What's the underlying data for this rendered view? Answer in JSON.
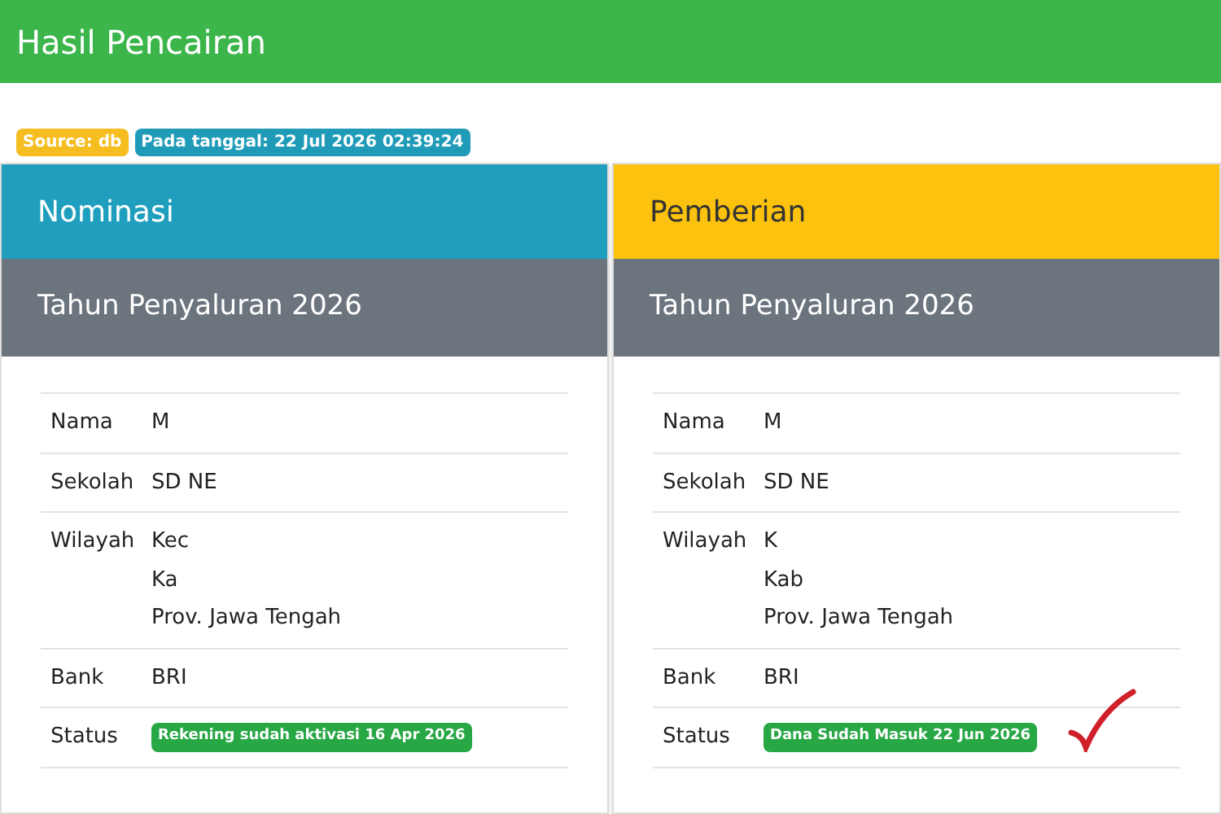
{
  "header": {
    "title": "Hasil Pencairan"
  },
  "badges": [
    {
      "text": "Source: db",
      "color": "#f5bd1f"
    },
    {
      "text": "Pada tanggal: 22 Jul 2026 02:39:24",
      "color": "#1f9bb8"
    }
  ],
  "cards": [
    {
      "title": "Nominasi",
      "color": "#1f9fbd",
      "subtitle": "Tahun Penyaluran 2026",
      "checked": false,
      "rows": [
        {
          "label": "Nama",
          "lines": [
            "M"
          ]
        },
        {
          "label": "Sekolah",
          "lines": [
            "SD NE"
          ]
        },
        {
          "label": "Wilayah",
          "lines": [
            "Kec",
            "Ka",
            "Prov. Jawa Tengah"
          ]
        },
        {
          "label": "Bank",
          "lines": [
            "BRI"
          ]
        },
        {
          "label": "Status",
          "badge": "Rekening sudah aktivasi 16 Apr 2026"
        }
      ]
    },
    {
      "title": "Pemberian",
      "color": "#fdc20d",
      "subtitle": "Tahun Penyaluran 2026",
      "checked": true,
      "rows": [
        {
          "label": "Nama",
          "lines": [
            "M"
          ]
        },
        {
          "label": "Sekolah",
          "lines": [
            "SD NE"
          ]
        },
        {
          "label": "Wilayah",
          "lines": [
            "K",
            "Kab",
            "Prov. Jawa Tengah"
          ]
        },
        {
          "label": "Bank",
          "lines": [
            "BRI"
          ]
        },
        {
          "label": "Status",
          "badge": "Dana Sudah Masuk 22 Jun 2026"
        }
      ]
    }
  ]
}
